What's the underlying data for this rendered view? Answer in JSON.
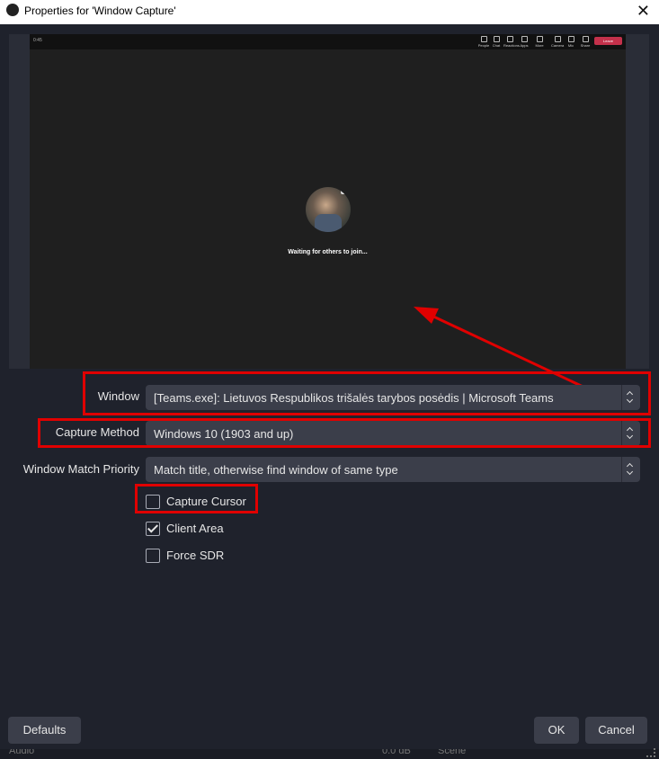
{
  "window": {
    "title": "Properties for 'Window Capture'",
    "close_glyph": "✕"
  },
  "preview": {
    "teams_bar": {
      "time": "0:45",
      "items": [
        "People",
        "Chat",
        "Reactions",
        "Apps",
        "More",
        "Camera",
        "Mic",
        "Share"
      ],
      "leave_label": "Leave"
    },
    "waiting_text": "Waiting for others to join..."
  },
  "form": {
    "window_label": "Window",
    "window_value": "[Teams.exe]: Lietuvos Respublikos trišalės tarybos posėdis | Microsoft Teams",
    "capture_method_label": "Capture Method",
    "capture_method_value": "Windows 10 (1903 and up)",
    "match_priority_label": "Window Match Priority",
    "match_priority_value": "Match title, otherwise find window of same type"
  },
  "checkboxes": [
    {
      "label": "Capture Cursor",
      "checked": false
    },
    {
      "label": "Client Area",
      "checked": true
    },
    {
      "label": "Force SDR",
      "checked": false
    }
  ],
  "buttons": {
    "defaults": "Defaults",
    "ok": "OK",
    "cancel": "Cancel"
  },
  "background_strip": {
    "left": "Audio",
    "mid": "0.0 dB",
    "right": "Scene"
  },
  "annotation_color": "#e00000",
  "theme": {
    "background": "#1f222c",
    "control": "#3b3e4a",
    "teams_leave": "#c4314b"
  }
}
